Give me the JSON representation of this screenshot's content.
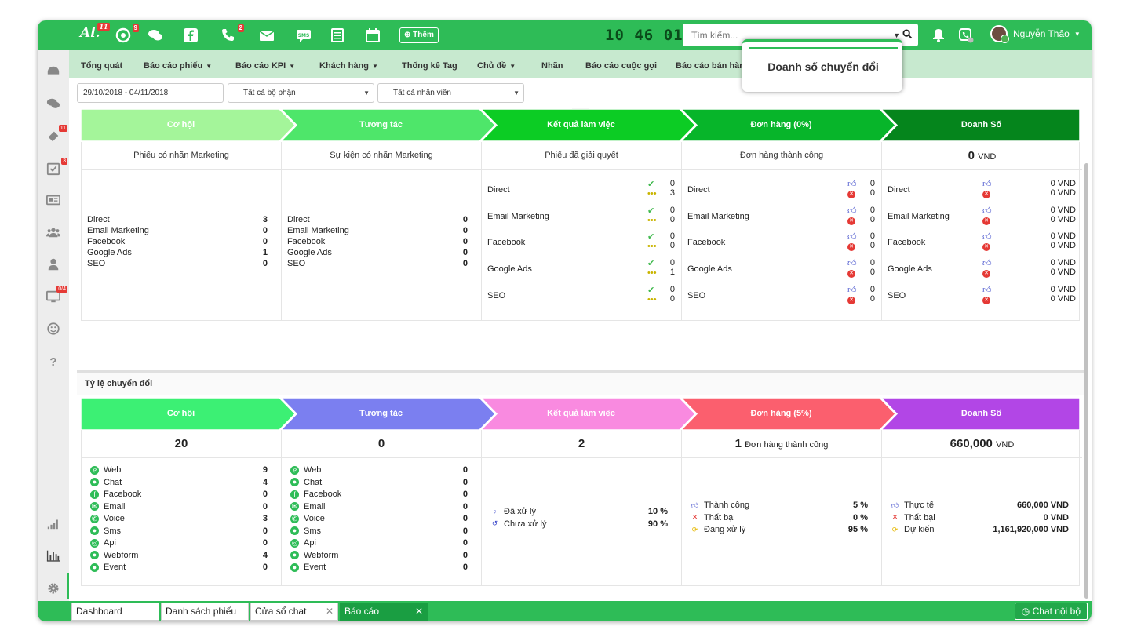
{
  "topbar": {
    "logo": "Al.",
    "badges": {
      "logo": "11",
      "chrome": "9",
      "phone": "2"
    },
    "add_label": "Thêm",
    "clock": {
      "h": "10",
      "m": "46",
      "s": "01"
    },
    "search_placeholder": "Tìm kiếm...",
    "user_name": "Nguyễn Thảo",
    "accent": "#2ebc57"
  },
  "sidebar": {
    "badges": {
      "ticket": "11",
      "task": "3",
      "screen": "0/4"
    }
  },
  "menu": {
    "items": [
      "Tổng quát",
      "Báo cáo phiếu",
      "Báo cáo KPI",
      "Khách hàng",
      "Thống kê Tag",
      "Chủ đề",
      "Nhãn",
      "Báo cáo cuộc gọi",
      "Báo cáo bán hàng"
    ]
  },
  "tooltip": "Doanh số chuyển đổi",
  "filters": {
    "date": "29/10/2018 - 04/11/2018",
    "department": "Tất cả bộ phận",
    "staff": "Tất cả nhân viên"
  },
  "funnel1": {
    "stages": [
      "Cơ hội",
      "Tương tác",
      "Kết quả làm việc",
      "Đơn hàng (0%)",
      "Doanh Số"
    ],
    "headers": [
      "Phiếu có nhãn Marketing",
      "Sự kiện có nhãn Marketing",
      "Phiếu đã giải quyết",
      "Đơn hàng thành công"
    ],
    "revenue_total": "0",
    "unit": "VND",
    "channels": [
      "Direct",
      "Email Marketing",
      "Facebook",
      "Google Ads",
      "SEO"
    ],
    "col1_values": [
      "3",
      "0",
      "0",
      "1",
      "0"
    ],
    "col2_values": [
      "0",
      "0",
      "0",
      "0",
      "0"
    ],
    "col3_values": [
      [
        "0",
        "3"
      ],
      [
        "0",
        "0"
      ],
      [
        "0",
        "0"
      ],
      [
        "0",
        "1"
      ],
      [
        "0",
        "0"
      ]
    ],
    "col4_values": [
      [
        "0",
        "0"
      ],
      [
        "0",
        "0"
      ],
      [
        "0",
        "0"
      ],
      [
        "0",
        "0"
      ],
      [
        "0",
        "0"
      ]
    ],
    "col5_values": [
      [
        "0 VND",
        "0 VND"
      ],
      [
        "0 VND",
        "0 VND"
      ],
      [
        "0 VND",
        "0 VND"
      ],
      [
        "0 VND",
        "0 VND"
      ],
      [
        "0 VND",
        "0 VND"
      ]
    ]
  },
  "funnel2": {
    "title": "Tỷ lệ chuyển đổi",
    "stages": [
      "Cơ hội",
      "Tương tác",
      "Kết quả làm việc",
      "Đơn hàng (5%)",
      "Doanh Số"
    ],
    "totals": [
      "20",
      "0",
      "2",
      "1",
      "660,000"
    ],
    "order_suffix": "Đơn hàng thành công",
    "unit": "VND",
    "sources": [
      "Web",
      "Chat",
      "Facebook",
      "Email",
      "Voice",
      "Sms",
      "Api",
      "Webform",
      "Event"
    ],
    "col1_values": [
      "9",
      "4",
      "0",
      "0",
      "3",
      "0",
      "0",
      "4",
      "0"
    ],
    "col2_values": [
      "0",
      "0",
      "0",
      "0",
      "0",
      "0",
      "0",
      "0",
      "0"
    ],
    "col3_rows": [
      {
        "label": "Đã xử lý",
        "value": "10 %"
      },
      {
        "label": "Chưa xử lý",
        "value": "90 %"
      }
    ],
    "col4_rows": [
      {
        "label": "Thành công",
        "value": "5 %"
      },
      {
        "label": "Thất bại",
        "value": "0 %"
      },
      {
        "label": "Đang xử lý",
        "value": "95 %"
      }
    ],
    "col5_rows": [
      {
        "label": "Thực tế",
        "value": "660,000 VND"
      },
      {
        "label": "Thất bại",
        "value": "0 VND"
      },
      {
        "label": "Dự kiến",
        "value": "1,161,920,000 VND"
      }
    ]
  },
  "bottom_tabs": [
    "Dashboard",
    "Danh sách phiếu",
    "Cửa sổ chat",
    "Báo cáo"
  ],
  "chat_button": "Chat nội bộ",
  "colors": {
    "f1": [
      "#a4f59a",
      "#4ee66a",
      "#0ccc24",
      "#07b52a",
      "#05851c"
    ],
    "f2": [
      "#3cf074",
      "#7b7ff0",
      "#f98ae0",
      "#fb5f6e",
      "#b246e6"
    ]
  }
}
